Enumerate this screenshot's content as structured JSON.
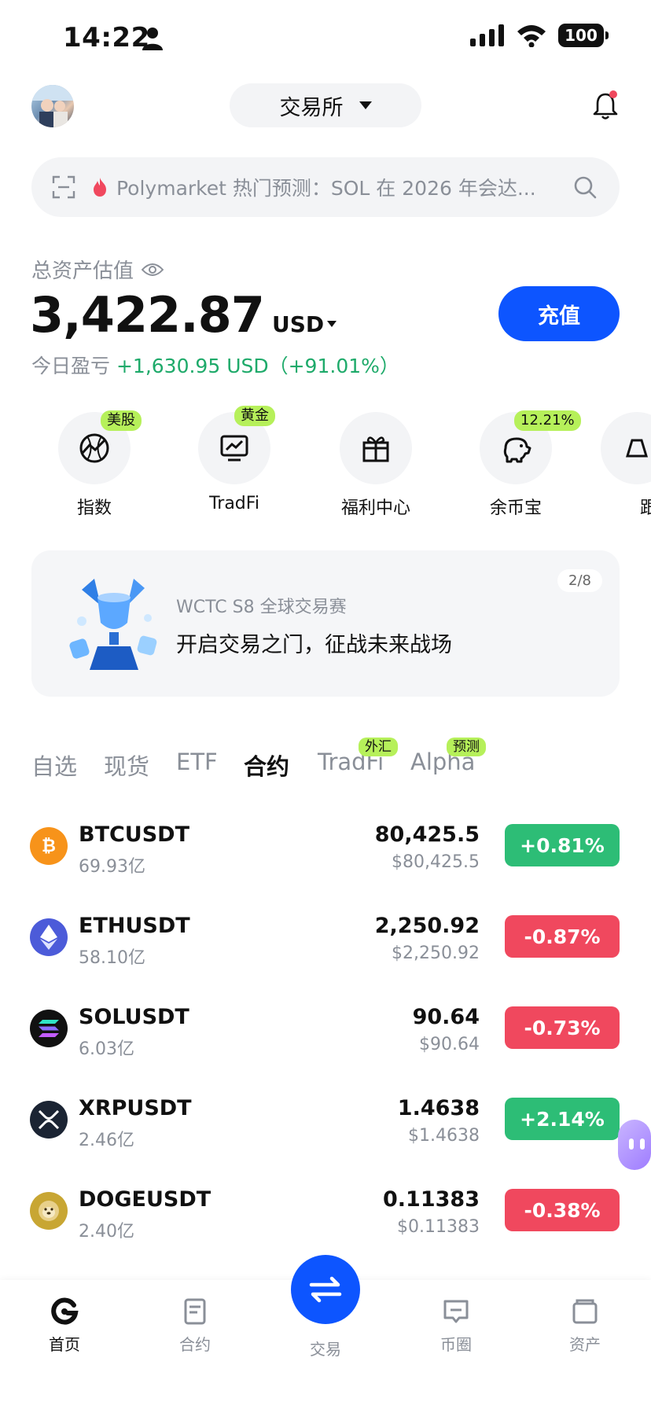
{
  "status_bar": {
    "time": "14:22",
    "battery": "100"
  },
  "header": {
    "exchange_label": "交易所"
  },
  "search": {
    "text": "Polymarket 热门预测：SOL 在 2026 年会达..."
  },
  "assets": {
    "label": "总资产估值",
    "value": "3,422.87",
    "currency": "USD",
    "pnl_label": "今日盈亏",
    "pnl_value": "+1,630.95 USD（+91.01%）",
    "deposit_label": "充值"
  },
  "shortcuts": [
    {
      "label": "指数",
      "tag": "美股",
      "icon": "index-globe-icon"
    },
    {
      "label": "TradFi",
      "tag": "黄金",
      "icon": "chart-monitor-icon"
    },
    {
      "label": "福利中心",
      "tag": "",
      "icon": "gift-icon"
    },
    {
      "label": "余币宝",
      "tag": "12.21%",
      "icon": "piggy-bank-icon"
    },
    {
      "label": "跟",
      "tag": "",
      "icon": "copy-trade-icon"
    }
  ],
  "banner": {
    "subtitle": "WCTC S8 全球交易赛",
    "title": "开启交易之门，征战未来战场",
    "page": "2/8"
  },
  "tabs": [
    {
      "label": "自选",
      "tag": ""
    },
    {
      "label": "现货",
      "tag": ""
    },
    {
      "label": "ETF",
      "tag": ""
    },
    {
      "label": "合约",
      "tag": "",
      "active": true
    },
    {
      "label": "TradFi",
      "tag": "外汇"
    },
    {
      "label": "Alpha",
      "tag": "预测"
    }
  ],
  "markets": [
    {
      "symbol": "BTCUSDT",
      "volume": "69.93亿",
      "price": "80,425.5",
      "usd": "$80,425.5",
      "change": "+0.81%",
      "direction": "up",
      "coin_color": "#f7931a",
      "icon": "bitcoin-icon"
    },
    {
      "symbol": "ETHUSDT",
      "volume": "58.10亿",
      "price": "2,250.92",
      "usd": "$2,250.92",
      "change": "-0.87%",
      "direction": "down",
      "coin_color": "#4c5bd9",
      "icon": "ethereum-icon"
    },
    {
      "symbol": "SOLUSDT",
      "volume": "6.03亿",
      "price": "90.64",
      "usd": "$90.64",
      "change": "-0.73%",
      "direction": "down",
      "coin_color": "#111111",
      "icon": "solana-icon"
    },
    {
      "symbol": "XRPUSDT",
      "volume": "2.46亿",
      "price": "1.4638",
      "usd": "$1.4638",
      "change": "+2.14%",
      "direction": "up",
      "coin_color": "#1b2433",
      "icon": "xrp-icon"
    },
    {
      "symbol": "DOGEUSDT",
      "volume": "2.40亿",
      "price": "0.11383",
      "usd": "$0.11383",
      "change": "-0.38%",
      "direction": "down",
      "coin_color": "#c8a633",
      "icon": "dogecoin-icon"
    }
  ],
  "bottom_nav": {
    "home": "首页",
    "futures": "合约",
    "trade": "交易",
    "feed": "币圈",
    "assets": "资产"
  },
  "colors": {
    "accent": "#0d55ff",
    "up": "#2dbd76",
    "down": "#f0485e",
    "tag": "#b6f05a"
  }
}
